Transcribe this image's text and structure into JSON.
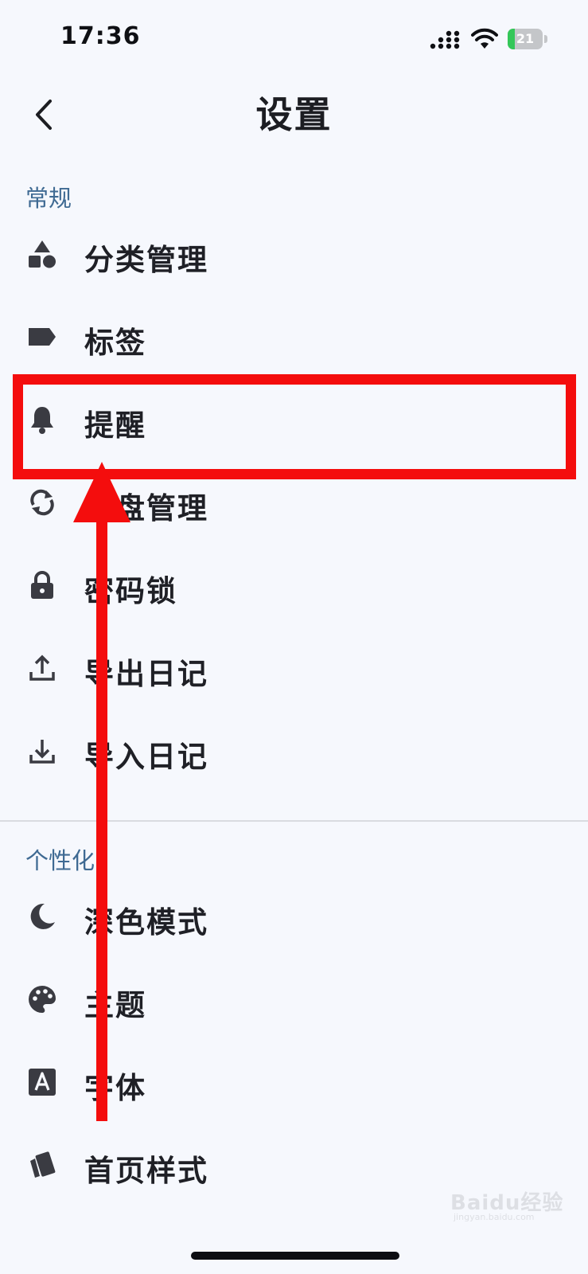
{
  "status_bar": {
    "time": "17:36",
    "battery_level": "21",
    "battery_fraction": 0.21,
    "charging": true
  },
  "header": {
    "title": "设置",
    "back_icon": "chevron-left-icon"
  },
  "sections": [
    {
      "header": "常规",
      "items": [
        {
          "label": "分类管理",
          "icon": "shapes-icon"
        },
        {
          "label": "标签",
          "icon": "tag-icon"
        },
        {
          "label": "提醒",
          "icon": "bell-icon"
        },
        {
          "label": "云盘管理",
          "icon": "sync-icon"
        },
        {
          "label": "密码锁",
          "icon": "lock-icon"
        },
        {
          "label": "导出日记",
          "icon": "upload-icon"
        },
        {
          "label": "导入日记",
          "icon": "download-icon"
        }
      ]
    },
    {
      "header": "个性化",
      "items": [
        {
          "label": "深色模式",
          "icon": "moon-icon"
        },
        {
          "label": "主题",
          "icon": "palette-icon"
        },
        {
          "label": "字体",
          "icon": "font-icon"
        },
        {
          "label": "首页样式",
          "icon": "cards-icon"
        }
      ]
    }
  ],
  "annotation": {
    "highlighted_item": "提醒",
    "color": "#f40d0d"
  },
  "watermark": {
    "text": "Baidu经验",
    "subtext": "jingyan.baidu.com"
  },
  "colors": {
    "background": "#f6f8fd",
    "section_header": "#3f6a93",
    "icon": "#3a3b42",
    "text": "#1f2026"
  }
}
